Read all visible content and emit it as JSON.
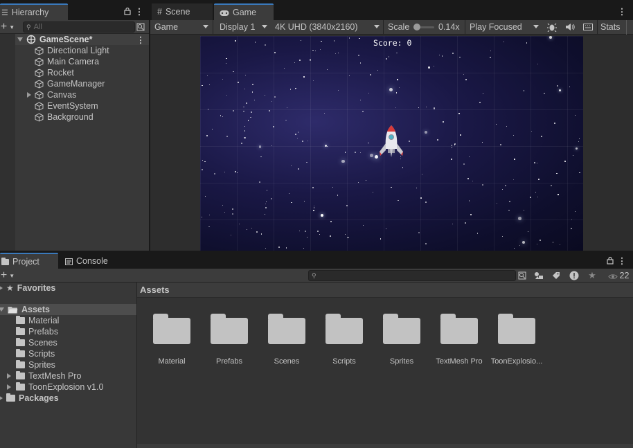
{
  "hierarchy": {
    "tab_label": "Hierarchy",
    "search_placeholder": "All",
    "scene_name": "GameScene*",
    "items": [
      {
        "label": "Directional Light",
        "expandable": false
      },
      {
        "label": "Main Camera",
        "expandable": false
      },
      {
        "label": "Rocket",
        "expandable": false
      },
      {
        "label": "GameManager",
        "expandable": false
      },
      {
        "label": "Canvas",
        "expandable": true
      },
      {
        "label": "EventSystem",
        "expandable": false
      },
      {
        "label": "Background",
        "expandable": false
      }
    ]
  },
  "view_tabs": {
    "scene_label": "Scene",
    "game_label": "Game"
  },
  "game_toolbar": {
    "view_mode": "Game",
    "display": "Display 1",
    "resolution": "4K UHD (3840x2160)",
    "scale_label": "Scale",
    "scale_value": "0.14x",
    "play_mode": "Play Focused",
    "stats_label": "Stats"
  },
  "game_view": {
    "score_text": "Score: 0"
  },
  "bottom_tabs": {
    "project_label": "Project",
    "console_label": "Console"
  },
  "project_tree": {
    "favorites_label": "Favorites",
    "assets_label": "Assets",
    "children": [
      {
        "label": "Material",
        "expandable": false
      },
      {
        "label": "Prefabs",
        "expandable": false
      },
      {
        "label": "Scenes",
        "expandable": false
      },
      {
        "label": "Scripts",
        "expandable": false
      },
      {
        "label": "Sprites",
        "expandable": false
      },
      {
        "label": "TextMesh Pro",
        "expandable": true
      },
      {
        "label": "ToonExplosion v1.0",
        "expandable": true
      }
    ],
    "packages_label": "Packages"
  },
  "assets_panel": {
    "breadcrumb": "Assets",
    "hidden_count": "22",
    "items": [
      "Material",
      "Prefabs",
      "Scenes",
      "Scripts",
      "Sprites",
      "TextMesh Pro",
      "ToonExplosio..."
    ]
  },
  "colors": {
    "accent": "#3a79bb",
    "panel_bg": "#383838",
    "toolbar_bg": "#3c3c3c",
    "selection_bg": "#4d4d4d"
  }
}
